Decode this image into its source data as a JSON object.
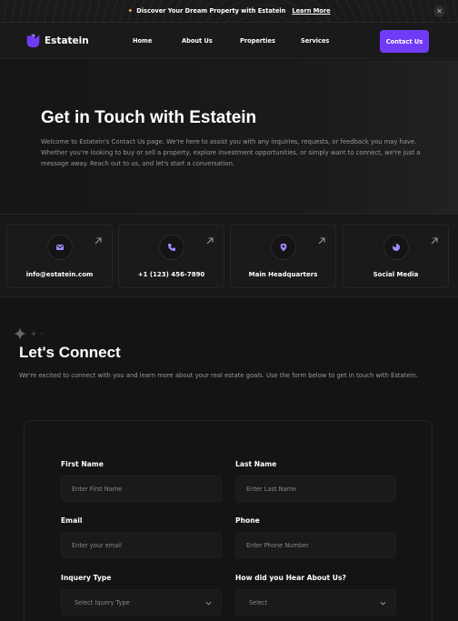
{
  "banner": {
    "sparkle": "✦",
    "text": "Discover Your Dream Property with Estatein",
    "link": "Learn More",
    "close": "✕"
  },
  "nav": {
    "logo": "Estatein",
    "links": [
      "Home",
      "About Us",
      "Properties",
      "Services"
    ],
    "cta": "Contact Us"
  },
  "hero": {
    "title": "Get in Touch with Estatein",
    "text": "Welcome to Estatein's Contact Us page. We're here to assist you with any inquiries, requests, or feedback you may have. Whether you're looking to buy or sell a property, explore investment opportunities, or simply want to connect, we're just a message away. Reach out to us, and let's start a conversation."
  },
  "cards": [
    {
      "label": "info@estatein.com",
      "icon": "mail-icon"
    },
    {
      "label": "+1 (123) 456-7890",
      "icon": "phone-icon"
    },
    {
      "label": "Main Headquarters",
      "icon": "location-icon"
    },
    {
      "label": "Social Media",
      "icon": "social-icon"
    }
  ],
  "connect": {
    "title": "Let's Connect",
    "text": "We're excited to connect with you and learn more about your real estate goals. Use the form below to get in touch with Estatein."
  },
  "form": {
    "first_name_label": "First Name",
    "first_name_placeholder": "Enter First Name",
    "last_name_label": "Last Name",
    "last_name_placeholder": "Enter Last Name",
    "email_label": "Email",
    "email_placeholder": "Enter your email",
    "phone_label": "Phone",
    "phone_placeholder": "Enter Phone Number",
    "inquiry_label": "Inquery Type",
    "inquiry_value": "Select Iquery Type",
    "hear_label": "How did you Hear About Us?",
    "hear_value": "Select"
  },
  "colors": {
    "accent": "#703bf7",
    "icon_purple": "#a685fa",
    "background": "#141414"
  }
}
